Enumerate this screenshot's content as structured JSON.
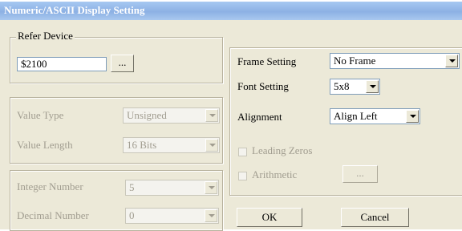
{
  "window": {
    "title": "Numeric/ASCII Display Setting"
  },
  "refer_device": {
    "legend": "Refer Device",
    "value": "$2100",
    "browse_label": "..."
  },
  "value_group": {
    "value_type": {
      "label": "Value Type",
      "selected": "Unsigned"
    },
    "value_length": {
      "label": "Value Length",
      "selected": "16 Bits"
    }
  },
  "number_group": {
    "integer_number": {
      "label": "Integer Number",
      "selected": "5"
    },
    "decimal_number": {
      "label": "Decimal Number",
      "selected": "0"
    }
  },
  "right_panel": {
    "frame_setting": {
      "label": "Frame Setting",
      "selected": "No Frame"
    },
    "font_setting": {
      "label": "Font Setting",
      "selected": "5x8"
    },
    "alignment": {
      "label": "Alignment",
      "selected": "Align Left"
    },
    "leading_zeros": {
      "label": "Leading Zeros",
      "checked": false
    },
    "arithmetic": {
      "label": "Arithmetic",
      "checked": false,
      "button_label": "..."
    }
  },
  "buttons": {
    "ok": "OK",
    "cancel": "Cancel"
  }
}
